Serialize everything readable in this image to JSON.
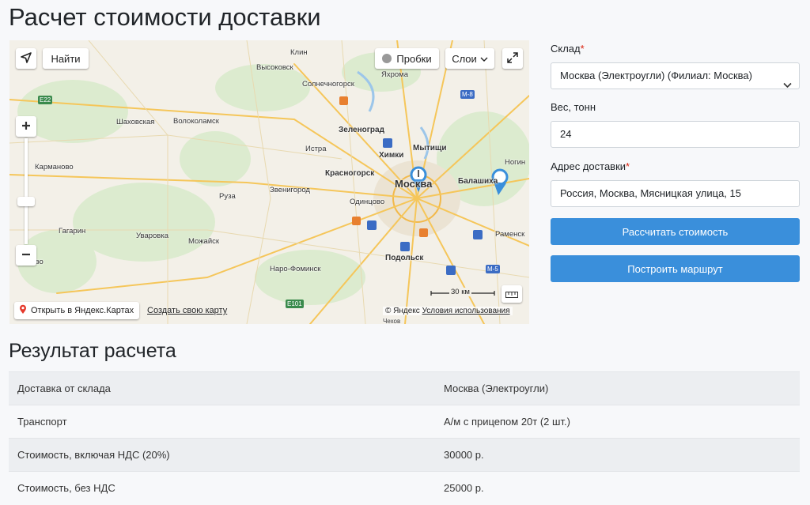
{
  "page_title": "Расчет стоимости доставки",
  "map": {
    "find_label": "Найти",
    "traffic_label": "Пробки",
    "layers_label": "Слои",
    "open_yandex_label": "Открыть в Яндекс.Картах",
    "create_map_label": "Создать свою карту",
    "copyright": "© Яндекс",
    "terms_label": "Условия использования",
    "scale_label": "30 км",
    "places": [
      "Клин",
      "Высоковск",
      "Солнечногорск",
      "Яхрома",
      "Шаховская",
      "Волоколамск",
      "Зеленоград",
      "Химки",
      "Мытищи",
      "Истра",
      "Красногорск",
      "Москва",
      "Балашиха",
      "Ногин",
      "Карманово",
      "Звенигород",
      "Руза",
      "Одинцово",
      "Гагарин",
      "Уваровка",
      "Можайск",
      "Раменск",
      "Наро-Фоминск",
      "Подольск",
      "Тучково",
      "Чехов"
    ],
    "highways": [
      "E22",
      "M-8",
      "M-5",
      "E101"
    ]
  },
  "form": {
    "warehouse_label": "Склад",
    "warehouse_value": "Москва (Электроугли) (Филиал: Москва)",
    "weight_label": "Вес, тонн",
    "weight_value": "24",
    "address_label": "Адрес доставки",
    "address_value": "Россия, Москва, Мясницкая улица, 15",
    "required_mark": "*",
    "calculate_button": "Рассчитать стоимость",
    "route_button": "Построить маршрут"
  },
  "results": {
    "title": "Результат расчета",
    "rows": [
      {
        "label": "Доставка от склада",
        "value": "Москва (Электроугли)"
      },
      {
        "label": "Транспорт",
        "value": "А/м с прицепом 20т (2 шт.)"
      },
      {
        "label": "Стоимость, включая НДС (20%)",
        "value": "30000 р."
      },
      {
        "label": "Стоимость, без НДС",
        "value": "25000 р."
      }
    ]
  }
}
